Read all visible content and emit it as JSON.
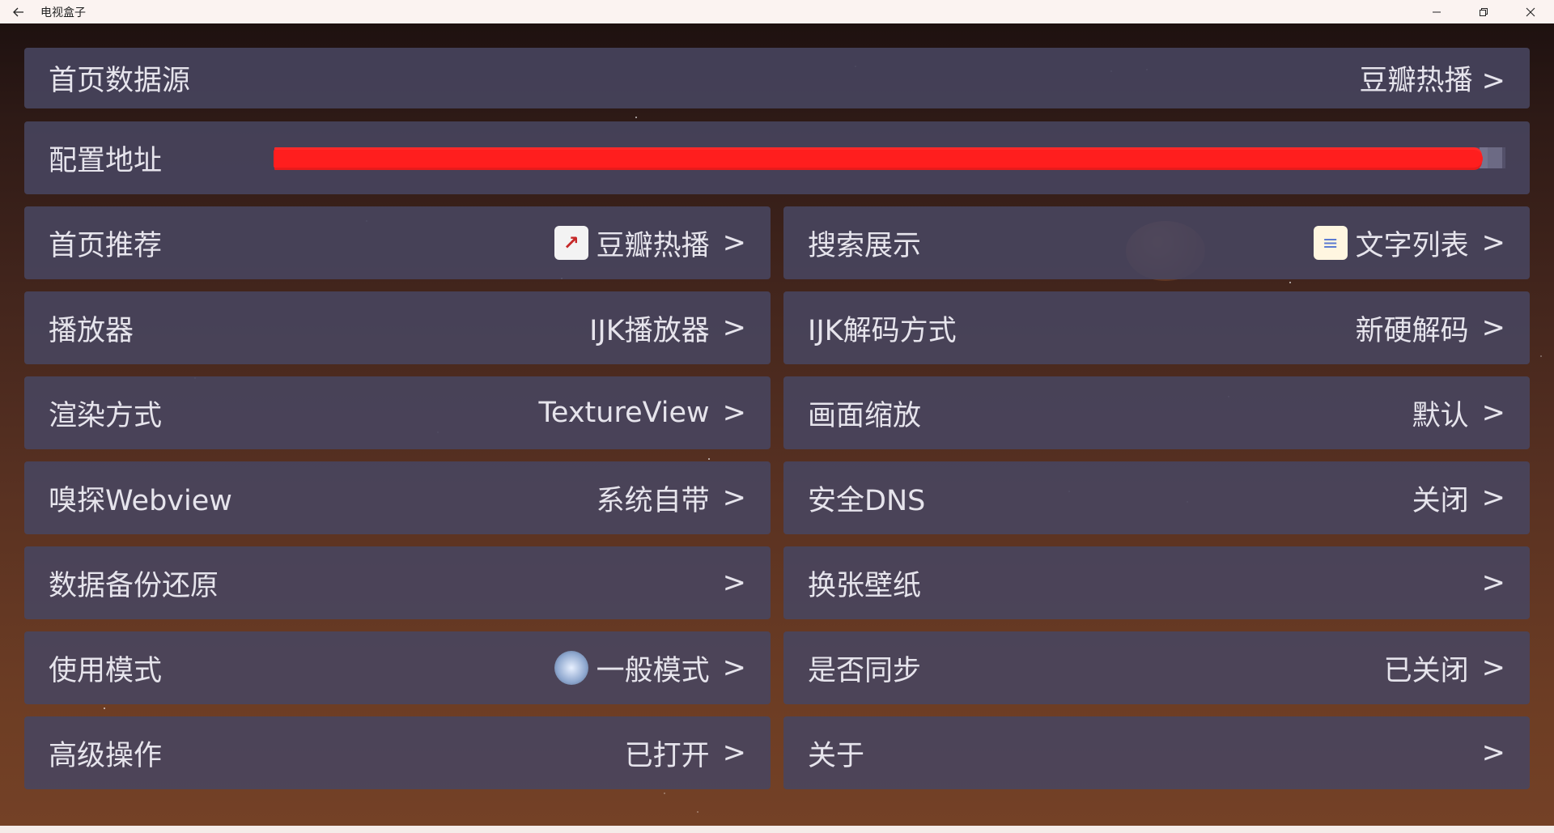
{
  "window": {
    "title": "电视盒子"
  },
  "settings": {
    "home_source": {
      "label": "首页数据源",
      "value": "豆瓣热播 >"
    },
    "config_url": {
      "label": "配置地址"
    },
    "left": [
      {
        "label": "首页推荐",
        "value": "豆瓣热播",
        "icon": "chart-icon"
      },
      {
        "label": "播放器",
        "value": "IJK播放器"
      },
      {
        "label": "渲染方式",
        "value": "TextureView"
      },
      {
        "label": "嗅探Webview",
        "value": "系统自带"
      },
      {
        "label": "数据备份还原",
        "value": ""
      },
      {
        "label": "使用模式",
        "value": "一般模式",
        "icon": "disc-icon"
      },
      {
        "label": "高级操作",
        "value": "已打开"
      }
    ],
    "right": [
      {
        "label": "搜索展示",
        "value": "文字列表",
        "icon": "memo-icon"
      },
      {
        "label": "IJK解码方式",
        "value": "新硬解码"
      },
      {
        "label": "画面缩放",
        "value": "默认"
      },
      {
        "label": "安全DNS",
        "value": "关闭"
      },
      {
        "label": "换张壁纸",
        "value": ""
      },
      {
        "label": "是否同步",
        "value": "已关闭"
      },
      {
        "label": "关于",
        "value": ""
      }
    ],
    "chevron": ">"
  }
}
